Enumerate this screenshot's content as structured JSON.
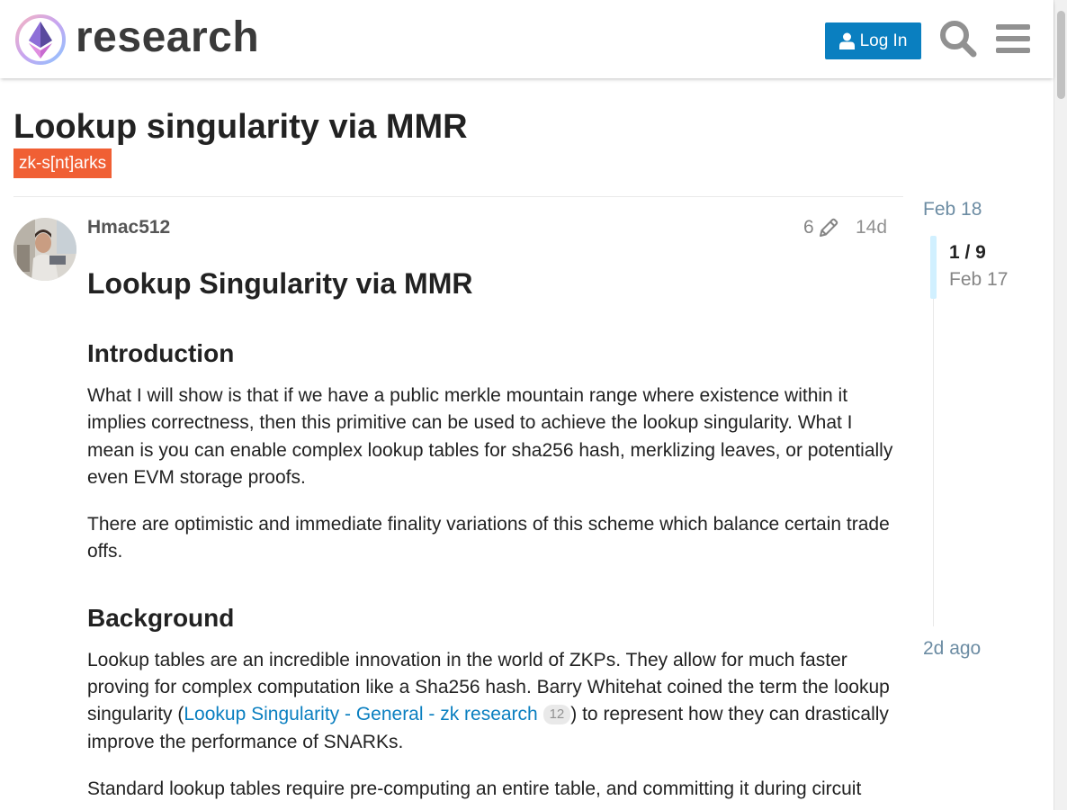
{
  "header": {
    "site_name": "research",
    "login_label": "Log In"
  },
  "topic": {
    "title": "Lookup singularity via MMR",
    "category": "zk-s[nt]arks"
  },
  "post": {
    "username": "Hmac512",
    "edit_count": "6",
    "age": "14d",
    "heading": "Lookup Singularity via MMR",
    "intro_heading": "Introduction",
    "intro_p1": "What I will show is that if we have a public merkle mountain range where existence within it implies correctness, then this primitive can be used to achieve the lookup singularity. What I mean is you can enable complex lookup tables for sha256 hash, merklizing leaves, or potentially even EVM storage proofs.",
    "intro_p2": "There are optimistic and immediate finality variations of this scheme which balance certain trade offs.",
    "background_heading": "Background",
    "bg_p1_before": "Lookup tables are an incredible innovation in the world of ZKPs. They allow for much faster proving for complex computation like a Sha256 hash. Barry Whitehat coined the term the lookup singularity (",
    "bg_link_text": "Lookup Singularity - General - zk research",
    "bg_link_clicks": "12",
    "bg_p1_after": ") to represent how they can drastically improve the performance of SNARKs.",
    "bg_p2": "Standard lookup tables require pre-computing an entire table, and committing it during circuit"
  },
  "timeline": {
    "top_date": "Feb 18",
    "position": "1 / 9",
    "position_date": "Feb 17",
    "bottom_label": "2d ago"
  },
  "colors": {
    "accent": "#0a7fc0",
    "category": "#f05f34",
    "timeline_handle": "#d1f0ff"
  },
  "icons": [
    "ethereum-logo",
    "user-icon",
    "search-icon",
    "hamburger-menu-icon",
    "pencil-icon"
  ]
}
